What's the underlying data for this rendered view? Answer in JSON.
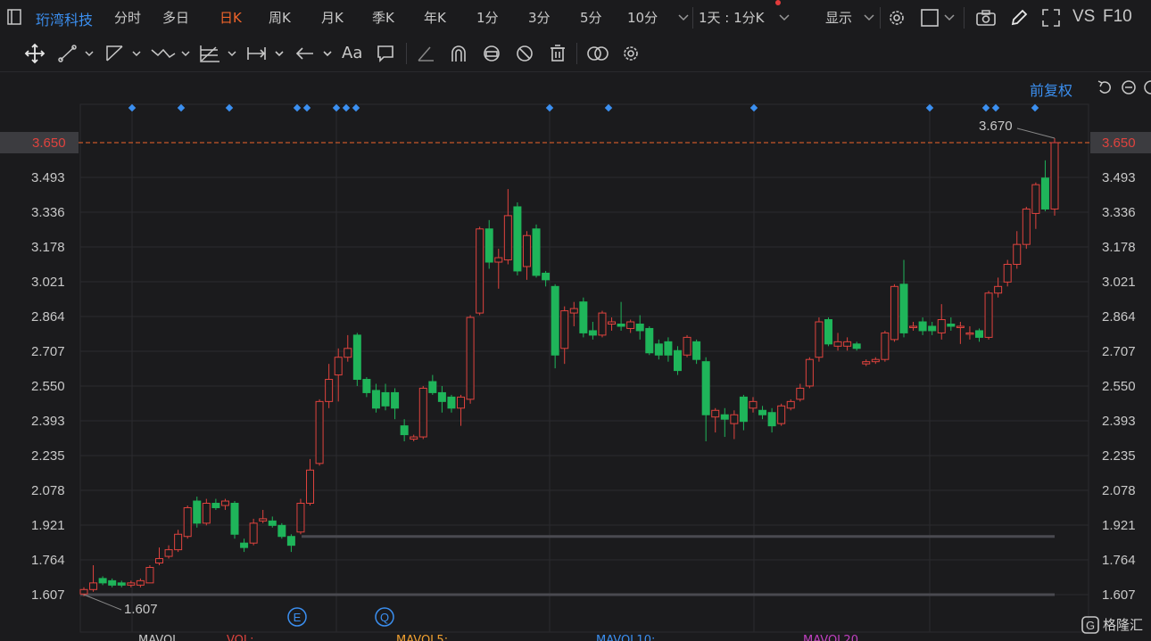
{
  "header": {
    "stock_name": "珩湾科技",
    "tabs": [
      "分时",
      "多日",
      "日K",
      "周K",
      "月K",
      "季K",
      "年K",
      "1分",
      "3分",
      "5分",
      "10分"
    ],
    "active_tab": "日K",
    "period_selector": "1天 : 1分K",
    "display_label": "显示",
    "vs_label": "VS",
    "f10_label": "F10"
  },
  "chart_toolbar": {
    "adjust_label": "前复权",
    "text_tool_label": "Aa"
  },
  "chart_data": {
    "type": "candlestick",
    "ylim": [
      1.607,
      3.65
    ],
    "y_ticks": [
      "3.650",
      "3.493",
      "3.336",
      "3.178",
      "3.021",
      "2.864",
      "2.707",
      "2.550",
      "2.393",
      "2.235",
      "2.078",
      "1.921",
      "1.764",
      "1.607"
    ],
    "current_price_label": "3.650",
    "high_annotation": "3.670",
    "low_annotation": "1.607",
    "event_markers": [
      "E",
      "Q"
    ],
    "candles": [
      [
        1.61,
        1.63,
        1.6,
        1.64
      ],
      [
        1.63,
        1.66,
        1.62,
        1.74
      ],
      [
        1.68,
        1.66,
        1.65,
        1.69
      ],
      [
        1.67,
        1.65,
        1.64,
        1.68
      ],
      [
        1.66,
        1.65,
        1.64,
        1.67
      ],
      [
        1.65,
        1.66,
        1.64,
        1.67
      ],
      [
        1.65,
        1.67,
        1.64,
        1.68
      ],
      [
        1.66,
        1.73,
        1.66,
        1.74
      ],
      [
        1.75,
        1.77,
        1.74,
        1.82
      ],
      [
        1.78,
        1.81,
        1.77,
        1.83
      ],
      [
        1.81,
        1.88,
        1.8,
        1.9
      ],
      [
        1.87,
        2.0,
        1.86,
        2.01
      ],
      [
        2.03,
        1.93,
        1.91,
        2.05
      ],
      [
        1.93,
        2.02,
        1.92,
        2.04
      ],
      [
        2.02,
        2.0,
        1.99,
        2.04
      ],
      [
        2.01,
        2.03,
        1.99,
        2.04
      ],
      [
        2.02,
        1.88,
        1.86,
        2.03
      ],
      [
        1.84,
        1.82,
        1.8,
        1.86
      ],
      [
        1.84,
        1.93,
        1.83,
        1.95
      ],
      [
        1.94,
        1.95,
        1.93,
        1.99
      ],
      [
        1.94,
        1.92,
        1.91,
        1.96
      ],
      [
        1.92,
        1.87,
        1.86,
        1.93
      ],
      [
        1.87,
        1.83,
        1.8,
        1.88
      ],
      [
        1.89,
        2.02,
        1.88,
        2.04
      ],
      [
        2.02,
        2.17,
        2.01,
        2.22
      ],
      [
        2.2,
        2.48,
        2.19,
        2.49
      ],
      [
        2.48,
        2.58,
        2.45,
        2.65
      ],
      [
        2.6,
        2.68,
        2.48,
        2.72
      ],
      [
        2.68,
        2.72,
        2.66,
        2.78
      ],
      [
        2.78,
        2.58,
        2.55,
        2.79
      ],
      [
        2.58,
        2.52,
        2.5,
        2.59
      ],
      [
        2.53,
        2.45,
        2.43,
        2.56
      ],
      [
        2.52,
        2.46,
        2.44,
        2.56
      ],
      [
        2.52,
        2.45,
        2.4,
        2.54
      ],
      [
        2.37,
        2.33,
        2.3,
        2.4
      ],
      [
        2.31,
        2.32,
        2.3,
        2.33
      ],
      [
        2.32,
        2.54,
        2.31,
        2.55
      ],
      [
        2.57,
        2.52,
        2.51,
        2.6
      ],
      [
        2.52,
        2.48,
        2.43,
        2.55
      ],
      [
        2.5,
        2.45,
        2.43,
        2.51
      ],
      [
        2.45,
        2.5,
        2.37,
        2.51
      ],
      [
        2.49,
        2.86,
        2.47,
        2.87
      ],
      [
        2.88,
        3.26,
        2.87,
        3.27
      ],
      [
        3.26,
        3.11,
        3.08,
        3.3
      ],
      [
        3.11,
        3.13,
        2.99,
        3.17
      ],
      [
        3.12,
        3.32,
        3.1,
        3.44
      ],
      [
        3.36,
        3.07,
        3.05,
        3.38
      ],
      [
        3.09,
        3.23,
        3.03,
        3.25
      ],
      [
        3.26,
        3.05,
        3.04,
        3.28
      ],
      [
        3.06,
        3.03,
        3.0,
        3.07
      ],
      [
        3.0,
        2.69,
        2.63,
        3.01
      ],
      [
        2.72,
        2.89,
        2.65,
        2.91
      ],
      [
        2.88,
        2.9,
        2.82,
        2.93
      ],
      [
        2.93,
        2.79,
        2.77,
        2.95
      ],
      [
        2.8,
        2.78,
        2.76,
        2.84
      ],
      [
        2.78,
        2.88,
        2.77,
        2.89
      ],
      [
        2.83,
        2.84,
        2.8,
        2.86
      ],
      [
        2.83,
        2.82,
        2.8,
        2.93
      ],
      [
        2.81,
        2.84,
        2.79,
        2.85
      ],
      [
        2.83,
        2.8,
        2.76,
        2.87
      ],
      [
        2.81,
        2.7,
        2.69,
        2.82
      ],
      [
        2.74,
        2.69,
        2.67,
        2.76
      ],
      [
        2.75,
        2.69,
        2.66,
        2.77
      ],
      [
        2.71,
        2.62,
        2.6,
        2.73
      ],
      [
        2.69,
        2.77,
        2.68,
        2.78
      ],
      [
        2.75,
        2.67,
        2.65,
        2.76
      ],
      [
        2.66,
        2.42,
        2.3,
        2.68
      ],
      [
        2.41,
        2.44,
        2.34,
        2.45
      ],
      [
        2.42,
        2.4,
        2.32,
        2.45
      ],
      [
        2.38,
        2.42,
        2.31,
        2.44
      ],
      [
        2.5,
        2.39,
        2.35,
        2.51
      ],
      [
        2.45,
        2.48,
        2.43,
        2.5
      ],
      [
        2.44,
        2.42,
        2.4,
        2.46
      ],
      [
        2.43,
        2.37,
        2.34,
        2.45
      ],
      [
        2.38,
        2.46,
        2.37,
        2.47
      ],
      [
        2.45,
        2.48,
        2.44,
        2.49
      ],
      [
        2.49,
        2.54,
        2.48,
        2.56
      ],
      [
        2.55,
        2.67,
        2.54,
        2.68
      ],
      [
        2.68,
        2.84,
        2.66,
        2.86
      ],
      [
        2.85,
        2.74,
        2.73,
        2.86
      ],
      [
        2.73,
        2.75,
        2.71,
        2.79
      ],
      [
        2.73,
        2.75,
        2.71,
        2.77
      ],
      [
        2.74,
        2.72,
        2.71,
        2.75
      ],
      [
        2.65,
        2.66,
        2.64,
        2.67
      ],
      [
        2.66,
        2.67,
        2.65,
        2.68
      ],
      [
        2.67,
        2.79,
        2.66,
        2.8
      ],
      [
        2.76,
        3.0,
        2.75,
        3.01
      ],
      [
        3.01,
        2.79,
        2.77,
        3.12
      ],
      [
        2.82,
        2.82,
        2.8,
        2.84
      ],
      [
        2.84,
        2.8,
        2.78,
        2.86
      ],
      [
        2.82,
        2.8,
        2.78,
        2.84
      ],
      [
        2.79,
        2.85,
        2.76,
        2.92
      ],
      [
        2.83,
        2.82,
        2.8,
        2.86
      ],
      [
        2.82,
        2.82,
        2.74,
        2.84
      ],
      [
        2.79,
        2.79,
        2.76,
        2.82
      ],
      [
        2.8,
        2.77,
        2.75,
        2.81
      ],
      [
        2.77,
        2.97,
        2.76,
        2.98
      ],
      [
        2.97,
        3.0,
        2.95,
        3.04
      ],
      [
        3.02,
        3.1,
        3.0,
        3.12
      ],
      [
        3.1,
        3.19,
        3.08,
        3.25
      ],
      [
        3.19,
        3.35,
        3.17,
        3.36
      ],
      [
        3.33,
        3.46,
        3.26,
        3.47
      ],
      [
        3.49,
        3.35,
        3.34,
        3.57
      ],
      [
        3.35,
        3.65,
        3.32,
        3.67
      ]
    ]
  },
  "bottom": {
    "indicators": [
      "MAVOL",
      "VOL:",
      "MAVOL5:",
      "MAVOL10:",
      "MAVOL20"
    ],
    "watermark": "格隆汇"
  },
  "colors": {
    "up": "#e0433e",
    "down": "#1fb55a",
    "accent": "#f0642a",
    "link": "#3b8ff0",
    "grid": "#2b2b2e"
  }
}
